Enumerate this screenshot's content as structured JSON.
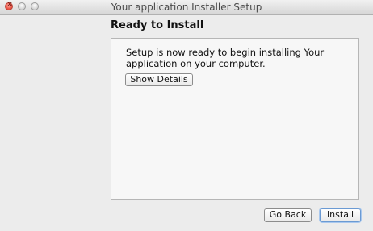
{
  "window": {
    "title": "Your application Installer Setup"
  },
  "page": {
    "heading": "Ready to Install",
    "message": "Setup is now ready to begin installing Your application on your computer.",
    "show_details_label": "Show Details"
  },
  "footer": {
    "back_label": "Go Back",
    "install_label": "Install"
  },
  "colors": {
    "window_bg": "#ececec",
    "panel_bg": "#f7f7f7",
    "close_button": "#f05c4e",
    "default_button_focus": "#6b9ad3"
  }
}
